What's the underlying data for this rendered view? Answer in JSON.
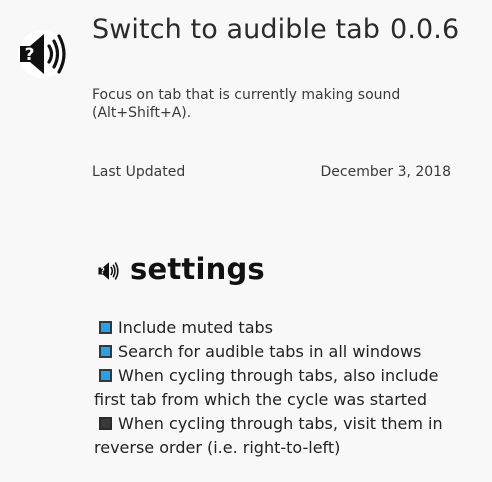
{
  "extension": {
    "title": "Switch to audible tab",
    "version": "0.0.6",
    "description": "Focus on tab that is currently making sound (Alt+Shift+A).",
    "icon": "speaker-question-icon"
  },
  "meta": {
    "updated_label": "Last Updated",
    "updated_value": "December 3, 2018"
  },
  "settings": {
    "heading": "settings",
    "icon": "speaker-question-icon",
    "options": [
      {
        "label": "Include muted tabs",
        "checked": true
      },
      {
        "label": "Search for audible tabs in all windows",
        "checked": true
      },
      {
        "label": "When cycling through tabs, also include first tab from which the cycle was started",
        "checked": true
      },
      {
        "label": "When cycling through tabs, visit them in reverse order (i.e. right-to-left)",
        "checked": false
      }
    ]
  },
  "colors": {
    "background": "#f8f8f8",
    "checkbox_checked": "#2e9fe0",
    "checkbox_unchecked": "#3a3a3a"
  }
}
